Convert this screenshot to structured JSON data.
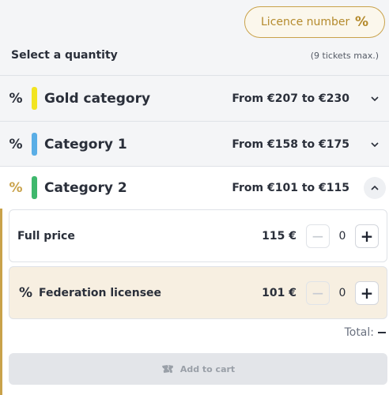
{
  "licence": {
    "label": "Licence number",
    "icon": "%"
  },
  "quantity": {
    "title": "Select a quantity",
    "max": "(9 tickets max.)"
  },
  "categories": [
    {
      "icon": "%",
      "name": "Gold category",
      "range": "From €207 to €230",
      "color": "#f2e422"
    },
    {
      "icon": "%",
      "name": "Category 1",
      "range": "From €158 to €175",
      "color": "#5aaee6"
    },
    {
      "icon": "%",
      "name": "Category 2",
      "range": "From €101 to €115",
      "color": "#3fb86d"
    }
  ],
  "prices": [
    {
      "label": "Full price",
      "price": "115 €",
      "qty": "0",
      "minus": "−",
      "plus": "+"
    },
    {
      "icon": "%",
      "label": "Federation licensee",
      "price": "101 €",
      "qty": "0",
      "minus": "−",
      "plus": "+"
    }
  ],
  "total": {
    "label": "Total:"
  },
  "cart": {
    "label": "Add to cart"
  },
  "colors": {
    "accent": "#c9a24a",
    "licensee_bg": "#f7efe1"
  }
}
